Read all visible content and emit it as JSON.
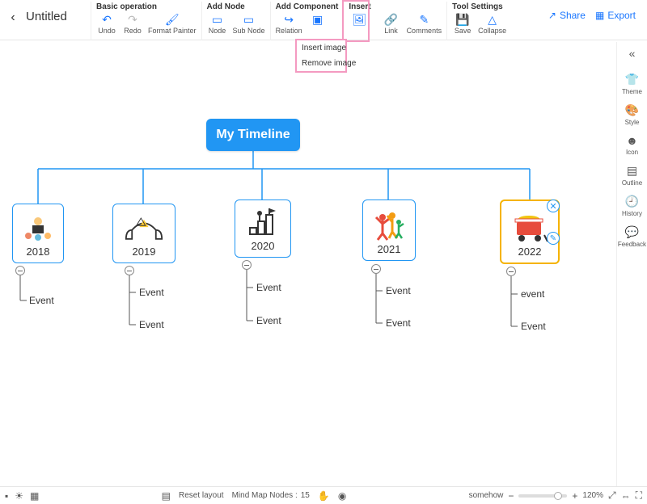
{
  "header": {
    "doc_title": "Untitled",
    "share": "Share",
    "export": "Export"
  },
  "toolbar": {
    "basic_operation": {
      "label": "Basic operation",
      "undo": "Undo",
      "redo": "Redo",
      "format_painter": "Format Painter"
    },
    "add_node": {
      "label": "Add Node",
      "node": "Node",
      "sub_node": "Sub Node"
    },
    "add_component": {
      "label": "Add Component",
      "relation": "Relation"
    },
    "insert": {
      "label": "Insert",
      "image": ""
    },
    "inline_tools": {
      "link": "Link",
      "comments": "Comments"
    },
    "tool_settings": {
      "label": "Tool Settings",
      "save": "Save",
      "collapse": "Collapse"
    }
  },
  "insert_menu": {
    "insert_image": "Insert image",
    "remove_image": "Remove image"
  },
  "right_rail": {
    "collapse": "«",
    "theme": "Theme",
    "style": "Style",
    "icon": "Icon",
    "outline": "Outline",
    "history": "History",
    "feedback": "Feedback"
  },
  "mindmap": {
    "root": "My Timeline",
    "years": [
      {
        "year": "2018",
        "events": [
          "Event"
        ]
      },
      {
        "year": "2019",
        "events": [
          "Event",
          "Event"
        ]
      },
      {
        "year": "2020",
        "events": [
          "Event",
          "Event"
        ]
      },
      {
        "year": "2021",
        "events": [
          "Event",
          "Event"
        ]
      },
      {
        "year": "2022",
        "events": [
          "event",
          "Event"
        ]
      }
    ]
  },
  "bottom": {
    "reset_layout": "Reset layout",
    "nodes_label": "Mind Map Nodes :",
    "node_count": "15",
    "zoom": "120%"
  }
}
